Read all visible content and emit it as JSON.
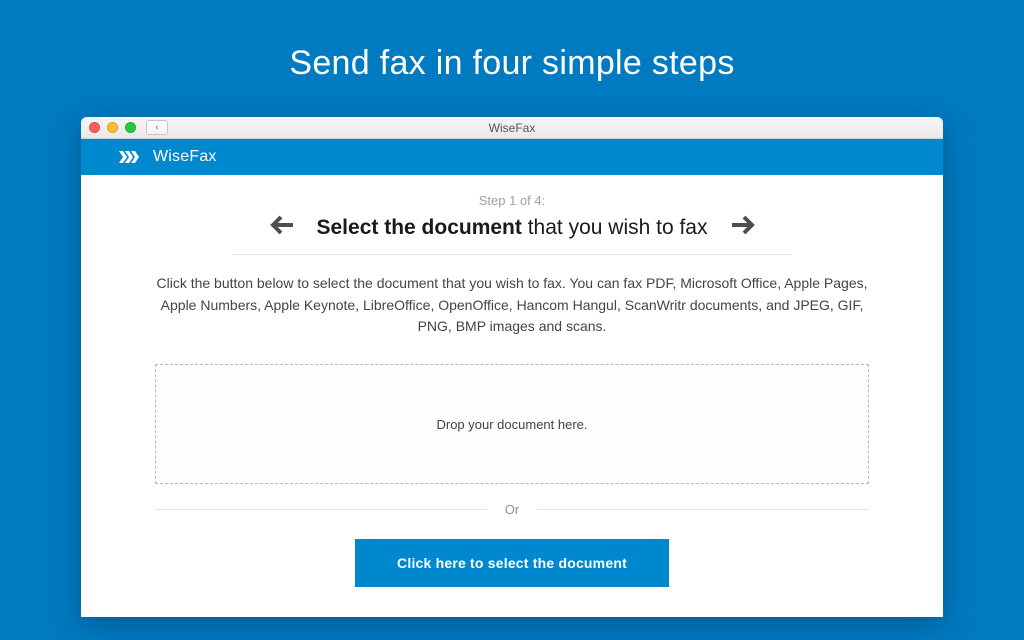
{
  "page": {
    "banner_title": "Send fax in four simple steps"
  },
  "window": {
    "title": "WiseFax"
  },
  "app": {
    "brand_name": "WiseFax"
  },
  "step": {
    "indicator": "Step 1 of 4:",
    "heading_bold": "Select the document",
    "heading_rest": " that you wish to fax",
    "instructions": "Click the button below to select the document that you wish to fax. You can fax PDF, Microsoft Office, Apple Pages, Apple Numbers, Apple Keynote, LibreOffice, OpenOffice, Hancom Hangul, ScanWritr documents, and JPEG, GIF, PNG, BMP images and scans.",
    "dropzone_label": "Drop your document here.",
    "or_label": "Or",
    "select_button_label": "Click here to select the document"
  }
}
